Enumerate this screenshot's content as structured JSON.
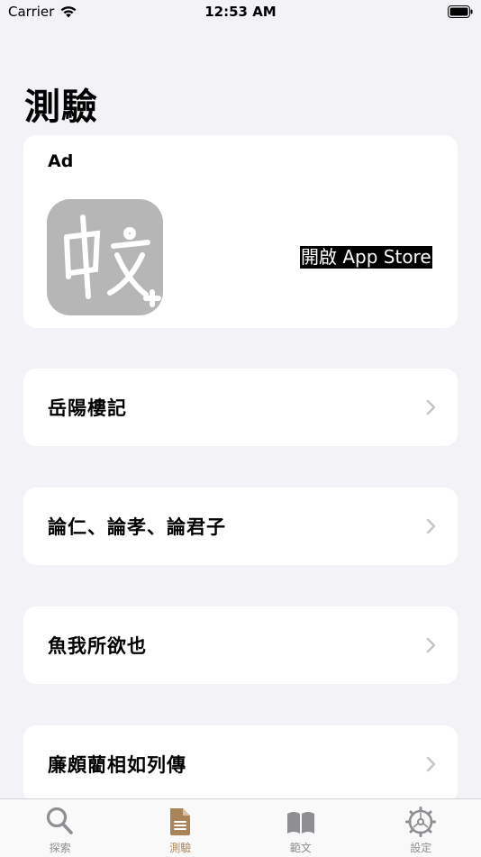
{
  "status_bar": {
    "carrier": "Carrier",
    "time": "12:53 AM"
  },
  "page": {
    "title": "測驗"
  },
  "ad": {
    "label": "Ad",
    "button": "開啟 App Store"
  },
  "lessons": [
    {
      "title": "岳陽樓記"
    },
    {
      "title": "論仁、論孝、論君子"
    },
    {
      "title": "魚我所欲也"
    },
    {
      "title": "廉頗藺相如列傳"
    }
  ],
  "tabs": [
    {
      "label": "探索",
      "icon": "search-icon",
      "active": false
    },
    {
      "label": "測驗",
      "icon": "document-icon",
      "active": true
    },
    {
      "label": "範文",
      "icon": "book-icon",
      "active": false
    },
    {
      "label": "設定",
      "icon": "gear-icon",
      "active": false
    }
  ],
  "colors": {
    "accent": "#A9845B",
    "inactive": "#8E8E93",
    "background": "#F2F2F7"
  }
}
